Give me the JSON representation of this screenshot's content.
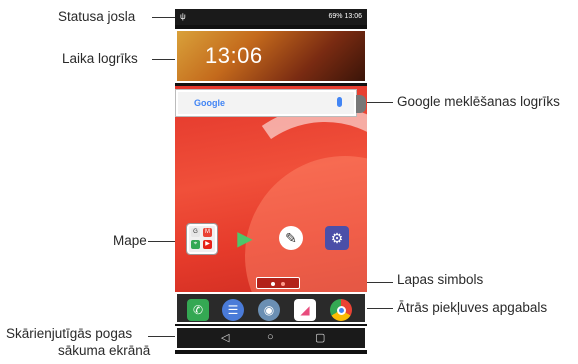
{
  "annotations": {
    "status_bar": "Statusa josla",
    "clock_widget": "Laika logrīks",
    "google_search": "Google meklēšanas logrīks",
    "folder": "Mape",
    "page_indicator": "Lapas simbols",
    "quick_access": "Ātrās piekļuves apgabals",
    "home_touch_buttons_line1": "Skārienjutīgās pogas",
    "home_touch_buttons_line2": "sākuma ekrānā"
  },
  "status": {
    "right": "69% 13:06"
  },
  "clock": {
    "time": "13:06"
  },
  "search": {
    "logo": "Google"
  },
  "navbar": {
    "back": "◁",
    "home": "○",
    "recent": "▢"
  },
  "colors": {
    "wallpaper": "#e3362b",
    "dock_phone": "#34a853",
    "dock_messages": "#4a7bd8",
    "dock_camera": "#6b8fb3",
    "dock_gallery": "#e84c7d",
    "dock_chrome": "#fbbc05"
  },
  "icons": {
    "apps": [
      "folder-icon",
      "play-store-icon",
      "pen-icon",
      "settings-icon"
    ],
    "dock": [
      "phone-icon",
      "messages-icon",
      "camera-icon",
      "gallery-icon",
      "chrome-icon"
    ]
  }
}
